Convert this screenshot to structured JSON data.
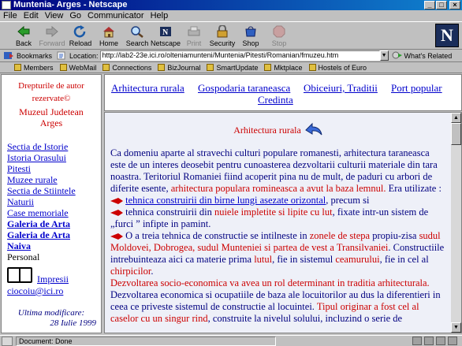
{
  "window": {
    "title": "Muntenia- Arges - Netscape",
    "controls": [
      "_",
      "□",
      "×"
    ]
  },
  "menu": [
    "File",
    "Edit",
    "View",
    "Go",
    "Communicator",
    "Help"
  ],
  "toolbar": [
    {
      "label": "Back",
      "icon": "back-arrow-icon",
      "enabled": true
    },
    {
      "label": "Forward",
      "icon": "forward-arrow-icon",
      "enabled": false
    },
    {
      "label": "Reload",
      "icon": "reload-icon",
      "enabled": true
    },
    {
      "label": "Home",
      "icon": "home-icon",
      "enabled": true
    },
    {
      "label": "Search",
      "icon": "search-icon",
      "enabled": true
    },
    {
      "label": "Netscape",
      "icon": "netscape-icon",
      "enabled": true
    },
    {
      "label": "Print",
      "icon": "print-icon",
      "enabled": false
    },
    {
      "label": "Security",
      "icon": "lock-icon",
      "enabled": true
    },
    {
      "label": "Shop",
      "icon": "shop-icon",
      "enabled": true
    },
    {
      "label": "Stop",
      "icon": "stop-icon",
      "enabled": false
    }
  ],
  "logo": "N",
  "location": {
    "bookmarks_label": "Bookmarks",
    "label": "Location:",
    "url": "http://lab2-23e.ici.ro/olteniamunteni/Muntenia/Pitesti/Romanian/fmuzeu.htm",
    "whats_related": "What's Related"
  },
  "personal_toolbar": [
    "Members",
    "WebMail",
    "Connections",
    "BizJournal",
    "SmartUpdate",
    "Mktplace",
    "Hostels of Euro"
  ],
  "left": {
    "copyright_line1": "Drepturile de autor",
    "copyright_line2": "rezervate©",
    "museum_line1": "Muzeul Judetean",
    "museum_line2": "Arges",
    "nav": [
      {
        "label": "Sectia de Istorie",
        "bold": false,
        "link": true
      },
      {
        "label": "Istoria Orasului",
        "bold": false,
        "link": true
      },
      {
        "label": "Pitesti",
        "bold": false,
        "link": true
      },
      {
        "label": "Muzee rurale",
        "bold": false,
        "link": true
      },
      {
        "label": "Sectia de Stiintele",
        "bold": false,
        "link": true
      },
      {
        "label": "Naturii",
        "bold": false,
        "link": true
      },
      {
        "label": "Case memoriale",
        "bold": false,
        "link": true
      },
      {
        "label": "Galeria de Arta",
        "bold": true,
        "link": true
      },
      {
        "label": "Galeria de Arta",
        "bold": true,
        "link": true
      },
      {
        "label": "Naiva",
        "bold": true,
        "link": true
      },
      {
        "label": "Personal",
        "bold": false,
        "link": false
      }
    ],
    "impresii": "Impresii",
    "email": "ciocoiu@ici.ro",
    "modified_label": "Ultima modificare:",
    "modified_date": "28 Iulie 1999"
  },
  "top_links": [
    "Arhitectura rurala",
    "Gospodaria taraneasca",
    "Obiceiuri, Traditii",
    "Port popular",
    "Credinta"
  ],
  "main": {
    "heading": "Arhitectura rurala",
    "p1a": "Ca domeniu aparte al stravechi culturi populare romanesti, arhitectura taraneasca este de un interes deosebit pentru cunoasterea dezvoltarii culturii materiale din tara noastra. Teritoriul Romaniei fiind acoperit pina nu de mult, de paduri cu arbori de diferite esente, ",
    "p1b": "arhitectura populara romineasca a avut la baza lemnul.",
    "p1c": " Era utilizate :",
    "b1a": "tehnica construirii din ",
    "b1b": "birne lungi asezate orizontal",
    "b1c": ", precum si",
    "b2a": "tehnica construirii din ",
    "b2b": "nuiele impletite si lipite cu lut",
    "b2c": ", fixate intr-un sistem de „furci ” infipte in pamint.",
    "b3a": "O a treia tehnica de constructie se intilneste in ",
    "b3b": "zonele de stepa",
    "b3c": " propiu-zisa ",
    "b3d": "sudul Moldovei, Dobrogea, sudul Munteniei si partea de vest a Transilvaniei",
    "b3e": ". Constructiile intrebuinteaza aici ca materie prima ",
    "b3f": "lutul",
    "b3g": ", fie in sistemul ",
    "b3h": "ceamurului",
    "b3i": ", fie in cel al ",
    "b3j": "chirpicilor",
    "b3k": ".",
    "p2a": "Dezvoltarea socio-economica va avea un rol determinant in traditia arhitecturala.",
    "p2b": " Dezvoltarea economica si ocupatiile de baza ale locuitorilor au dus la diferentieri in ceea ce priveste sistemul de constructie al locuintei. ",
    "p2c": "Tipul originar a fost cel al caselor cu un singur rind",
    "p2d": ", construite la nivelul solului, incluzind o serie de"
  },
  "status": {
    "message": "Document: Done"
  }
}
